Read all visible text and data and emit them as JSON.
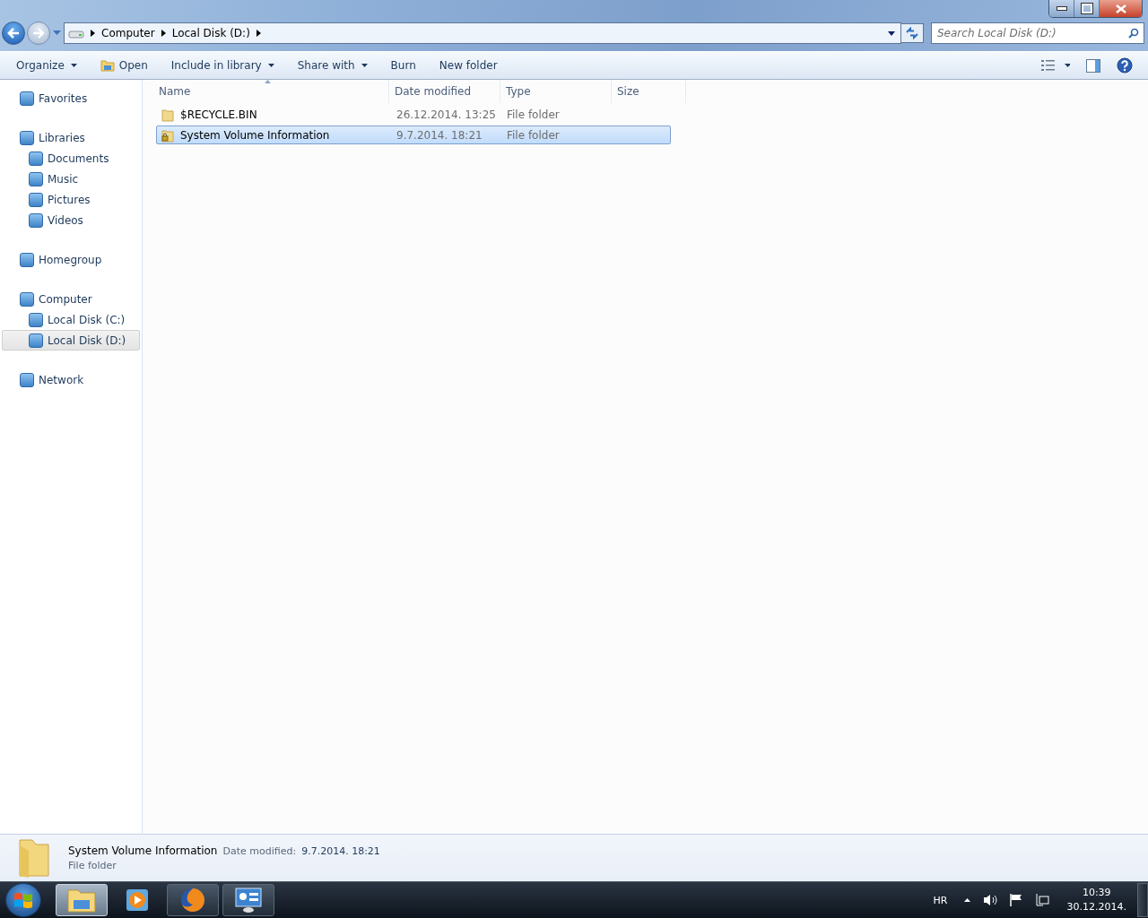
{
  "address": {
    "crumbs": [
      "Computer",
      "Local Disk (D:)"
    ]
  },
  "search": {
    "placeholder": "Search Local Disk (D:)"
  },
  "toolbar": {
    "buttons": [
      {
        "label": "Organize",
        "dropdown": true,
        "kind": "plain"
      },
      {
        "label": "Open",
        "dropdown": false,
        "kind": "open"
      },
      {
        "label": "Include in library",
        "dropdown": true,
        "kind": "plain"
      },
      {
        "label": "Share with",
        "dropdown": true,
        "kind": "plain"
      },
      {
        "label": "Burn",
        "dropdown": false,
        "kind": "plain"
      },
      {
        "label": "New folder",
        "dropdown": false,
        "kind": "plain"
      }
    ]
  },
  "sidebar": {
    "groups": [
      {
        "label": "Favorites",
        "selected": false
      },
      {
        "label": "Libraries",
        "selected": false,
        "children": [
          {
            "label": "Documents",
            "selected": false
          },
          {
            "label": "Music",
            "selected": false
          },
          {
            "label": "Pictures",
            "selected": false
          },
          {
            "label": "Videos",
            "selected": false
          }
        ]
      },
      {
        "label": "Homegroup",
        "selected": false
      },
      {
        "label": "Computer",
        "selected": false,
        "children": [
          {
            "label": "Local Disk (C:)",
            "selected": false
          },
          {
            "label": "Local Disk (D:)",
            "selected": true
          }
        ]
      },
      {
        "label": "Network",
        "selected": false
      }
    ]
  },
  "table": {
    "columns": [
      {
        "label": "Name",
        "sorted": true
      },
      {
        "label": "Date modified",
        "sorted": false
      },
      {
        "label": "Type",
        "sorted": false
      },
      {
        "label": "Size",
        "sorted": false
      }
    ],
    "rows": [
      {
        "name": "$RECYCLE.BIN",
        "date": "26.12.2014. 13:25",
        "type": "File folder",
        "locked": false,
        "selected": false
      },
      {
        "name": "System Volume Information",
        "date": "9.7.2014. 18:21",
        "type": "File folder",
        "locked": true,
        "selected": true
      }
    ]
  },
  "details": {
    "name": "System Volume Information",
    "date_label": "Date modified:",
    "date": "9.7.2014. 18:21",
    "type": "File folder"
  },
  "taskbar": {
    "apps": [
      {
        "kind": "explorer",
        "running": true,
        "selected": true
      },
      {
        "kind": "media",
        "running": false,
        "selected": false
      },
      {
        "kind": "firefox",
        "running": true,
        "selected": false
      },
      {
        "kind": "control",
        "running": true,
        "selected": false
      }
    ],
    "language": "HR",
    "time": "10:39",
    "date": "30.12.2014."
  }
}
